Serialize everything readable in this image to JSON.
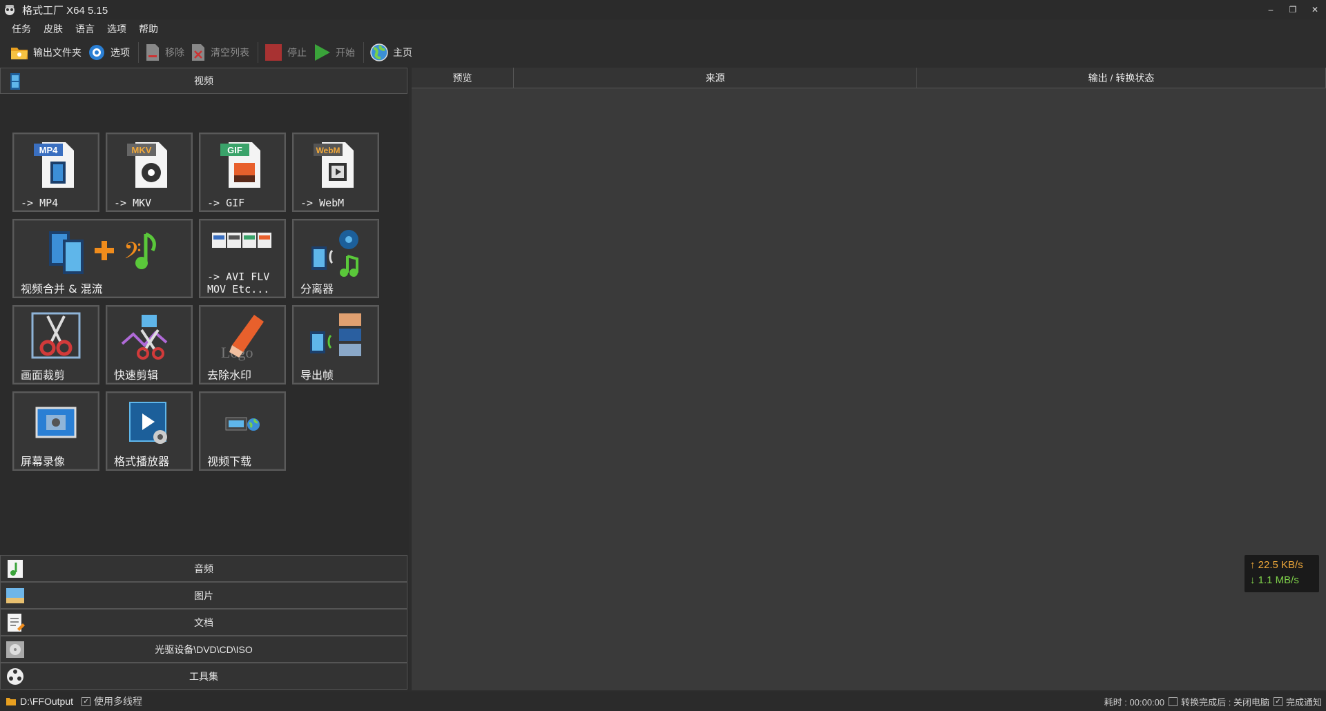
{
  "titlebar": {
    "title": "格式工厂 X64 5.15",
    "minimize": "–",
    "restore": "❐",
    "close": "✕"
  },
  "menu": [
    "任务",
    "皮肤",
    "语言",
    "选项",
    "帮助"
  ],
  "toolbar": {
    "output_folder": "输出文件夹",
    "options": "选项",
    "remove": "移除",
    "clear_list": "清空列表",
    "stop": "停止",
    "start": "开始",
    "home": "主页"
  },
  "left": {
    "video_header": "视频",
    "tiles": {
      "mp4_badge": "MP4",
      "mp4": "-> MP4",
      "mkv_badge": "MKV",
      "mkv": "-> MKV",
      "gif_badge": "GIF",
      "gif": "-> GIF",
      "webm_badge": "WebM",
      "webm": "-> WebM",
      "merge": "视频合并 & 混流",
      "avi": "-> AVI FLV\nMOV Etc...",
      "splitter": "分离器",
      "crop": "画面裁剪",
      "quick_cut": "快速剪辑",
      "watermark_logo": "Logo",
      "watermark": "去除水印",
      "export_frames": "导出帧",
      "screen_record": "屏幕录像",
      "player": "格式播放器",
      "download": "视频下载"
    },
    "categories": [
      "音频",
      "图片",
      "文档",
      "光驱设备\\DVD\\CD\\ISO",
      "工具集"
    ]
  },
  "right": {
    "columns": [
      "预览",
      "来源",
      "输出 / 转换状态"
    ],
    "speed_up": "↑ 22.5 KB/s",
    "speed_down": "↓ 1.1 MB/s"
  },
  "status": {
    "output_path": "D:\\FFOutput",
    "multithread": "使用多线程",
    "elapsed": "耗时 : 00:00:00",
    "after_convert": "转换完成后 : 关闭电脑",
    "notify": "完成通知",
    "multithread_checked": true,
    "after_convert_checked": false,
    "notify_checked": true
  }
}
